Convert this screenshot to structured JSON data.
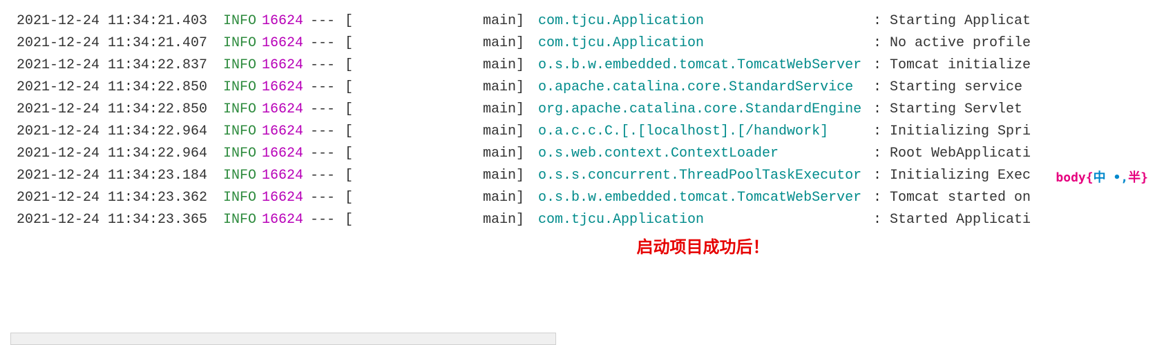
{
  "logs": [
    {
      "timestamp": "2021-12-24 11:34:21.403",
      "level": "INFO",
      "pid": "16624",
      "separator": "---",
      "bracket": "[",
      "thread": "main]",
      "logger": "com.tjcu.Application",
      "colon": ":",
      "message": "Starting Applicat"
    },
    {
      "timestamp": "2021-12-24 11:34:21.407",
      "level": "INFO",
      "pid": "16624",
      "separator": "---",
      "bracket": "[",
      "thread": "main]",
      "logger": "com.tjcu.Application",
      "colon": ":",
      "message": "No active profile"
    },
    {
      "timestamp": "2021-12-24 11:34:22.837",
      "level": "INFO",
      "pid": "16624",
      "separator": "---",
      "bracket": "[",
      "thread": "main]",
      "logger": "o.s.b.w.embedded.tomcat.TomcatWebServer",
      "colon": ":",
      "message": "Tomcat initialize"
    },
    {
      "timestamp": "2021-12-24 11:34:22.850",
      "level": "INFO",
      "pid": "16624",
      "separator": "---",
      "bracket": "[",
      "thread": "main]",
      "logger": "o.apache.catalina.core.StandardService",
      "colon": ":",
      "message": "Starting service"
    },
    {
      "timestamp": "2021-12-24 11:34:22.850",
      "level": "INFO",
      "pid": "16624",
      "separator": "---",
      "bracket": "[",
      "thread": "main]",
      "logger": "org.apache.catalina.core.StandardEngine",
      "colon": ":",
      "message": "Starting Servlet"
    },
    {
      "timestamp": "2021-12-24 11:34:22.964",
      "level": "INFO",
      "pid": "16624",
      "separator": "---",
      "bracket": "[",
      "thread": "main]",
      "logger": "o.a.c.c.C.[.[localhost].[/handwork]",
      "colon": ":",
      "message": "Initializing Spri"
    },
    {
      "timestamp": "2021-12-24 11:34:22.964",
      "level": "INFO",
      "pid": "16624",
      "separator": "---",
      "bracket": "[",
      "thread": "main]",
      "logger": "o.s.web.context.ContextLoader",
      "colon": ":",
      "message": "Root WebApplicati"
    },
    {
      "timestamp": "2021-12-24 11:34:23.184",
      "level": "INFO",
      "pid": "16624",
      "separator": "---",
      "bracket": "[",
      "thread": "main]",
      "logger": "o.s.s.concurrent.ThreadPoolTaskExecutor",
      "colon": ":",
      "message": "Initializing Exec"
    },
    {
      "timestamp": "2021-12-24 11:34:23.362",
      "level": "INFO",
      "pid": "16624",
      "separator": "---",
      "bracket": "[",
      "thread": "main]",
      "logger": "o.s.b.w.embedded.tomcat.TomcatWebServer",
      "colon": ":",
      "message": "Tomcat started on"
    },
    {
      "timestamp": "2021-12-24 11:34:23.365",
      "level": "INFO",
      "pid": "16624",
      "separator": "---",
      "bracket": "[",
      "thread": "main]",
      "logger": "com.tjcu.Application",
      "colon": ":",
      "message": "Started Applicati"
    }
  ],
  "success_banner": "启动项目成功后！",
  "ime": {
    "body": "body",
    "brace_open": "{",
    "chinese1": "中",
    "dot": "•,",
    "chinese2": "半",
    "brace_close": "}"
  }
}
